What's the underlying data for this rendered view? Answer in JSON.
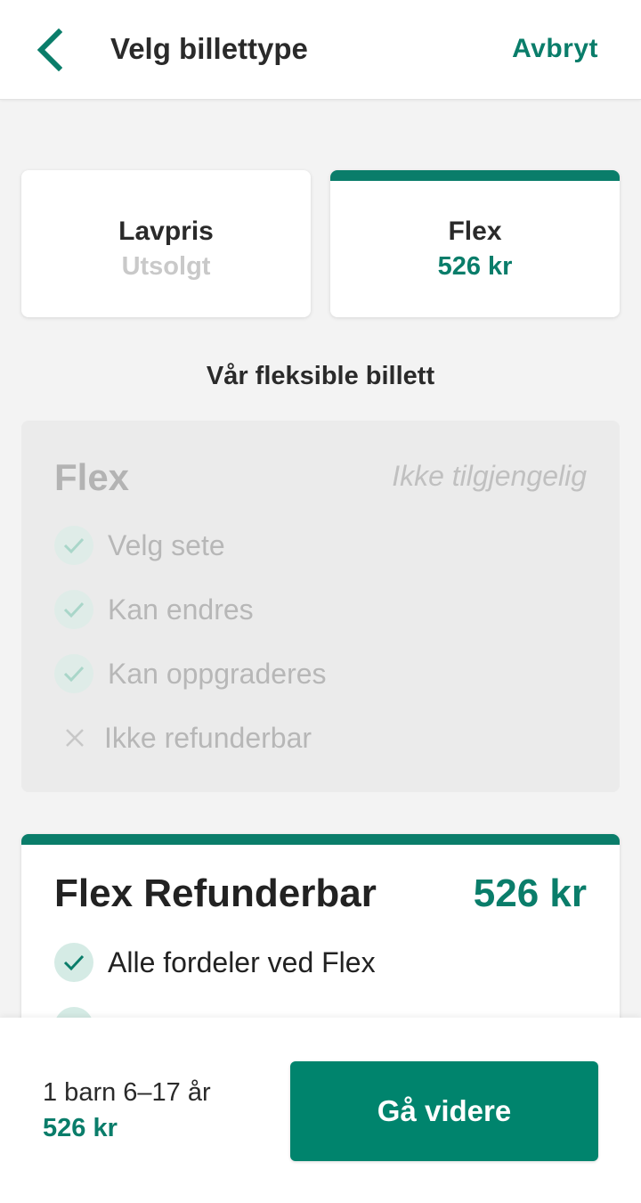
{
  "header": {
    "back_icon": "chevron-left-icon",
    "title": "Velg billettype",
    "cancel_label": "Avbryt"
  },
  "ticket_tabs": [
    {
      "name": "Lavpris",
      "sub": "Utsolgt",
      "selected": false,
      "available": false
    },
    {
      "name": "Flex",
      "sub": "526 kr",
      "selected": true,
      "available": true
    }
  ],
  "section_heading": "Vår fleksible billett",
  "flex_option": {
    "title": "Flex",
    "status": "Ikke tilgjengelig",
    "features": [
      {
        "label": "Velg sete",
        "icon": "check-icon"
      },
      {
        "label": "Kan endres",
        "icon": "check-icon"
      },
      {
        "label": "Kan oppgraderes",
        "icon": "check-icon"
      },
      {
        "label": "Ikke refunderbar",
        "icon": "cross-icon"
      }
    ]
  },
  "refund_option": {
    "title": "Flex Refunderbar",
    "price": "526 kr",
    "features": [
      {
        "label": "Alle fordeler ved Flex",
        "icon": "check-icon"
      }
    ]
  },
  "footer": {
    "passengers": "1 barn 6–17 år",
    "total": "526 kr",
    "continue_label": "Gå videre"
  },
  "colors": {
    "accent": "#0a7d6a",
    "button": "#00846d",
    "background": "#f3f3f3"
  }
}
